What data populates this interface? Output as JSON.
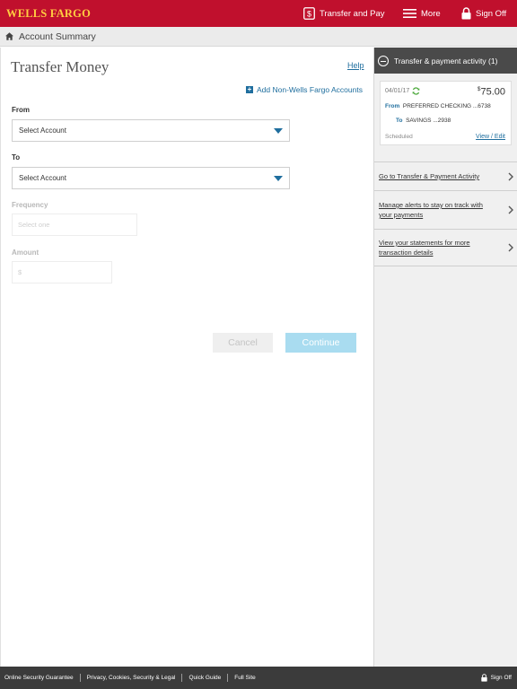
{
  "header": {
    "brand": "WELLS FARGO",
    "transfer_pay": "Transfer and Pay",
    "more": "More",
    "sign_off": "Sign Off"
  },
  "breadcrumb": {
    "label": "Account Summary"
  },
  "form": {
    "title": "Transfer Money",
    "help": "Help",
    "add_non_wf": "Add Non-Wells Fargo Accounts",
    "from_label": "From",
    "from_value": "Select Account",
    "to_label": "To",
    "to_value": "Select Account",
    "frequency_label": "Frequency",
    "frequency_placeholder": "Select one",
    "amount_label": "Amount",
    "amount_placeholder": "$",
    "cancel": "Cancel",
    "continue": "Continue"
  },
  "sidebar": {
    "header": "Transfer & payment activity (1)",
    "activity": {
      "date": "04/01/17",
      "currency": "$",
      "amount": "75.00",
      "from_tag": "From",
      "from_account": "PREFERRED CHECKING ...6738",
      "to_tag": "To",
      "to_account": "SAVINGS ...2938",
      "status": "Scheduled",
      "view_edit": "View / Edit"
    },
    "links": [
      "Go to Transfer & Payment Activity",
      "Manage alerts to stay on track with your payments",
      "View your statements for more transaction details"
    ]
  },
  "footer": {
    "links": [
      "Online Security Guarantee",
      "Privacy, Cookies, Security & Legal",
      "Quick Guide",
      "Full Site"
    ],
    "sign_off": "Sign Off"
  },
  "colors": {
    "brand_red": "#c0102d",
    "brand_gold": "#ffcd41",
    "link_blue": "#1f6e9e",
    "continue_blue": "#a9dcf0",
    "footer_dark": "#3b3b3b"
  },
  "icons": [
    "dollar-card-icon",
    "hamburger-icon",
    "lock-icon",
    "home-icon",
    "plus-square-icon",
    "caret-down-icon",
    "minus-circle-icon",
    "recurring-icon",
    "chevron-right-icon"
  ]
}
